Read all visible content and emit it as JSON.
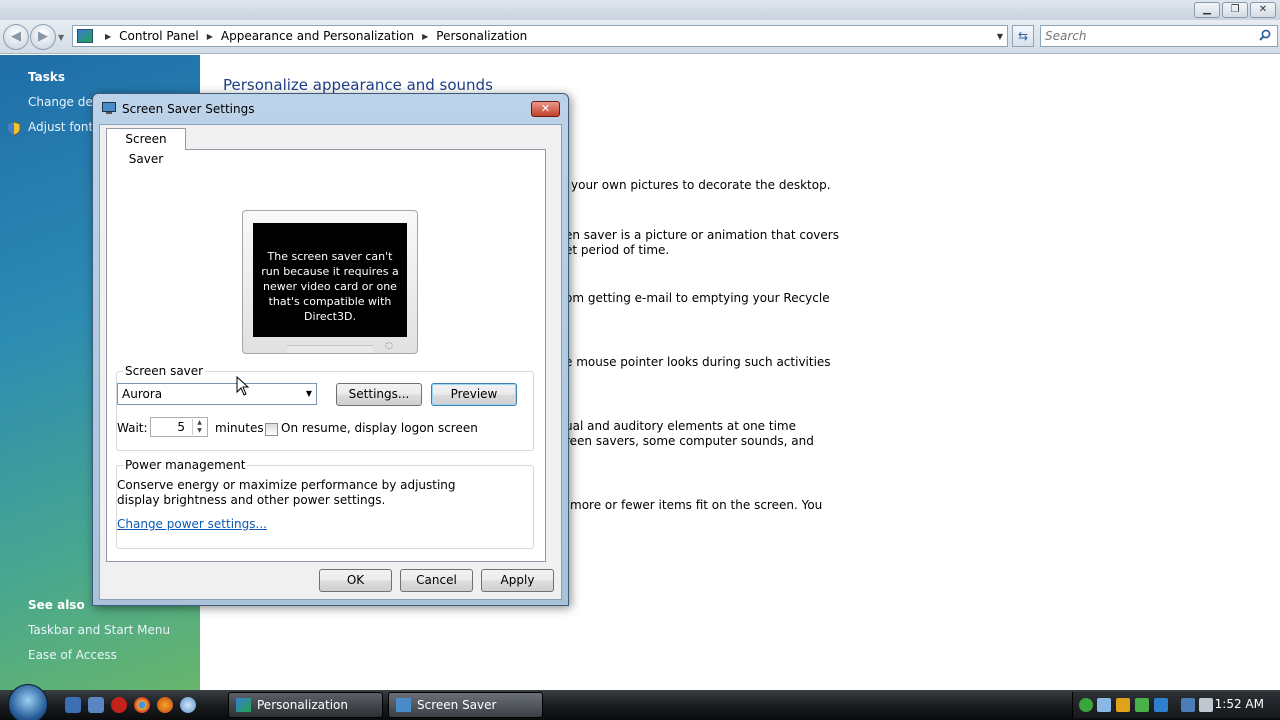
{
  "window": {
    "breadcrumbs": [
      "Control Panel",
      "Appearance and Personalization",
      "Personalization"
    ],
    "search_placeholder": "Search",
    "caption_buttons": [
      "minimize",
      "restore",
      "close"
    ]
  },
  "sidebar": {
    "tasks_header": "Tasks",
    "tasks": [
      "Change desi",
      "Adjust font s"
    ],
    "see_also_header": "See also",
    "see_also": [
      "Taskbar and Start Menu",
      "Ease of Access"
    ]
  },
  "main": {
    "title": "Personalize appearance and sounds",
    "lines": [
      "your own pictures to decorate the desktop.",
      "en saver is a picture or animation that covers",
      "et period of time.",
      "om getting e-mail to emptying your Recycle",
      "e mouse pointer looks during such activities",
      "ual and auditory elements at one time",
      "reen savers, some computer sounds, and",
      "more or fewer items fit on the screen. You"
    ]
  },
  "dialog": {
    "title": "Screen Saver Settings",
    "tab": "Screen Saver",
    "preview_message": "The screen saver can't run because it requires a newer video card or one that's compatible with Direct3D.",
    "screen_saver_group": "Screen saver",
    "selected_saver": "Aurora",
    "settings_button": "Settings...",
    "preview_button": "Preview",
    "wait_label": "Wait:",
    "wait_value": "5",
    "minutes_label": "minutes",
    "on_resume_label": "On resume, display logon screen",
    "on_resume_checked": false,
    "power_group": "Power management",
    "power_text": "Conserve energy or maximize performance by adjusting display brightness and other power settings.",
    "power_link": "Change power settings...",
    "ok_button": "OK",
    "cancel_button": "Cancel",
    "apply_button": "Apply"
  },
  "taskbar": {
    "tasks": [
      "Personalization",
      "Screen Saver Settings"
    ],
    "clock": "1:52 AM"
  },
  "colors": {
    "link": "#0c5bb6",
    "title_blue": "#1e3f87",
    "close_red": "#c3402b"
  }
}
